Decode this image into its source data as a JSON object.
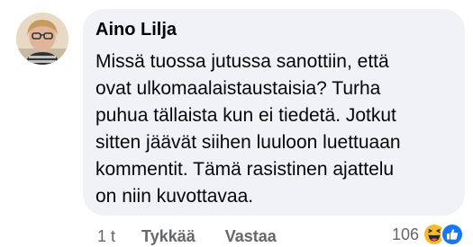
{
  "comment": {
    "author": "Aino Lilja",
    "lines": [
      "Missä tuossa jutussa sanottiin, että",
      "ovat ulkomaalaistaustaisia? Turha",
      "puhua tällaista kun ei tiedetä. Jotkut",
      "sitten jäävät siihen luuloon luettuaan",
      "kommentit. Tämä rasistinen ajattelu",
      "on niin kuvottavaa."
    ]
  },
  "actions": {
    "time": "1 t",
    "like_label": "Tykkää",
    "reply_label": "Vastaa"
  },
  "reactions": {
    "count": "106",
    "icons": [
      "haha-emoji-icon",
      "like-thumb-icon"
    ]
  },
  "colors": {
    "bubble": "#f0f2f5",
    "secondary_text": "#65676b",
    "like_blue": "#1877f2",
    "haha_yellow": "#f7b928"
  }
}
